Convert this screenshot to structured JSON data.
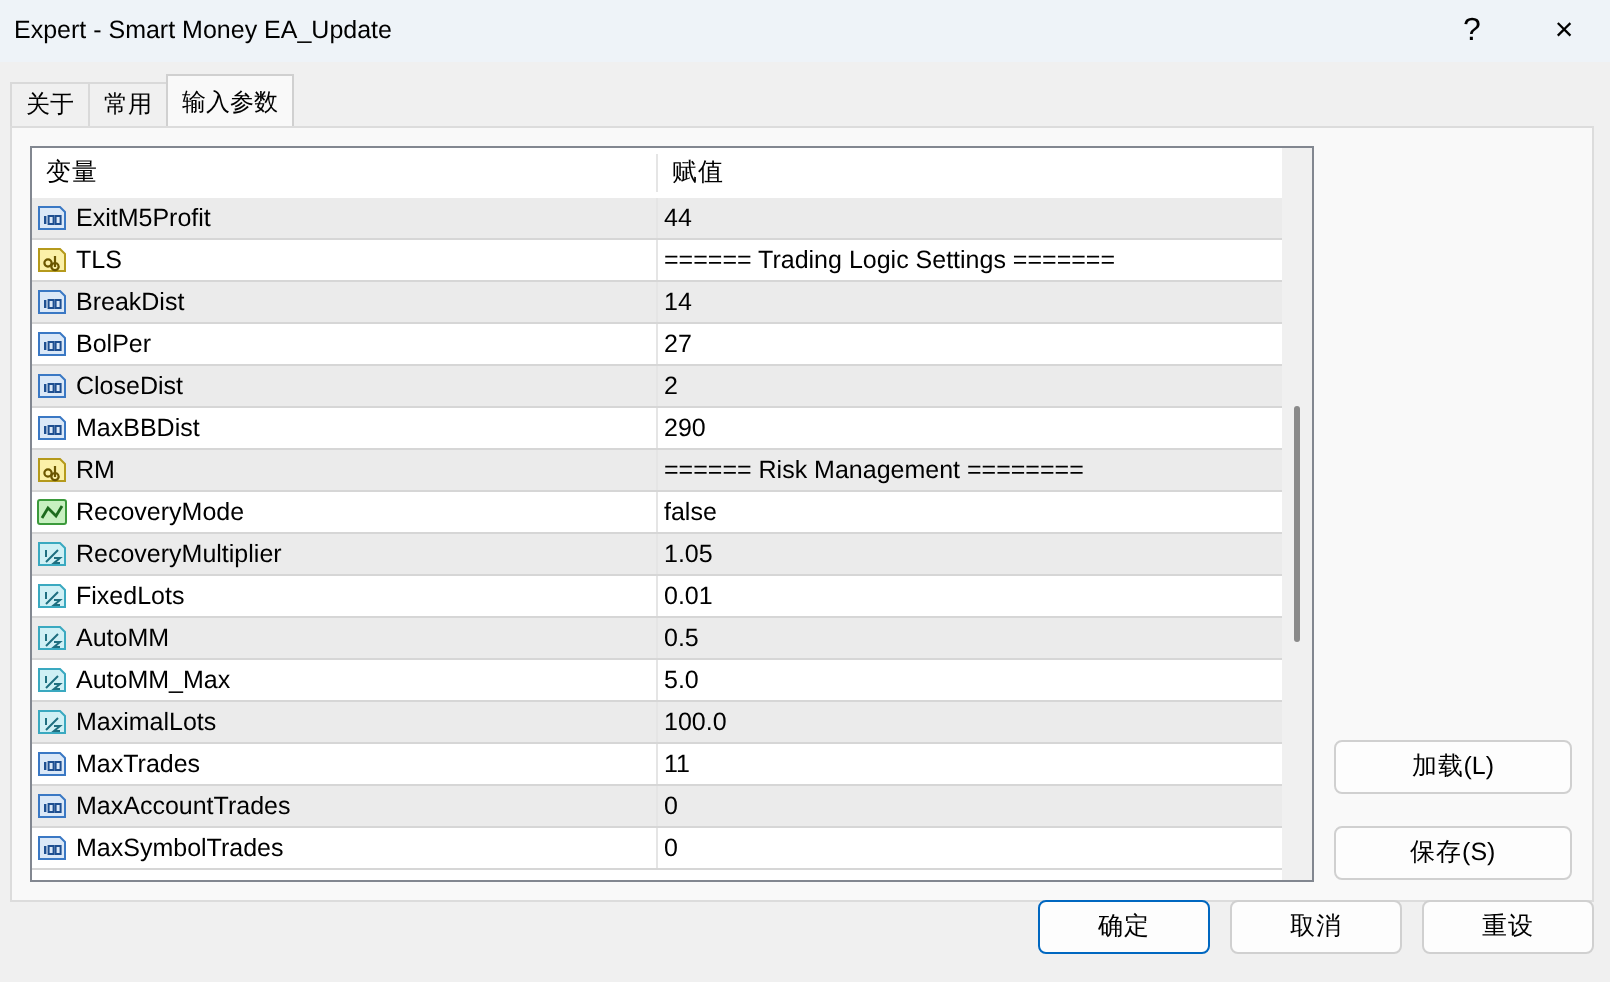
{
  "window": {
    "title": "Expert - Smart Money EA_Update"
  },
  "title_buttons": [
    "?",
    "×"
  ],
  "tabs": [
    {
      "label": "关于",
      "selected": false
    },
    {
      "label": "常用",
      "selected": false
    },
    {
      "label": "输入参数",
      "selected": true
    }
  ],
  "table": {
    "columns": [
      "变量",
      "赋值"
    ],
    "rows": [
      {
        "kind": "int",
        "name": "ExitM5Profit",
        "value": "44"
      },
      {
        "kind": "string",
        "name": "TLS",
        "value": "====== Trading Logic Settings ======="
      },
      {
        "kind": "int",
        "name": "BreakDist",
        "value": "14"
      },
      {
        "kind": "int",
        "name": "BolPer",
        "value": "27"
      },
      {
        "kind": "int",
        "name": "CloseDist",
        "value": "2"
      },
      {
        "kind": "int",
        "name": "MaxBBDist",
        "value": "290"
      },
      {
        "kind": "string",
        "name": "RM",
        "value": "====== Risk Management ========"
      },
      {
        "kind": "bool",
        "name": "RecoveryMode",
        "value": "false"
      },
      {
        "kind": "double",
        "name": "RecoveryMultiplier",
        "value": "1.05"
      },
      {
        "kind": "double",
        "name": "FixedLots",
        "value": "0.01"
      },
      {
        "kind": "double",
        "name": "AutoMM",
        "value": "0.5"
      },
      {
        "kind": "double",
        "name": "AutoMM_Max",
        "value": "5.0"
      },
      {
        "kind": "double",
        "name": "MaximalLots",
        "value": "100.0"
      },
      {
        "kind": "int",
        "name": "MaxTrades",
        "value": "11"
      },
      {
        "kind": "int",
        "name": "MaxAccountTrades",
        "value": "0"
      },
      {
        "kind": "int",
        "name": "MaxSymbolTrades",
        "value": "0"
      }
    ]
  },
  "side_buttons": [
    "加载(L)",
    "保存(S)"
  ],
  "buttons": [
    {
      "label": "确定",
      "default": true
    },
    {
      "label": "取消",
      "default": false
    },
    {
      "label": "重设",
      "default": false
    }
  ]
}
